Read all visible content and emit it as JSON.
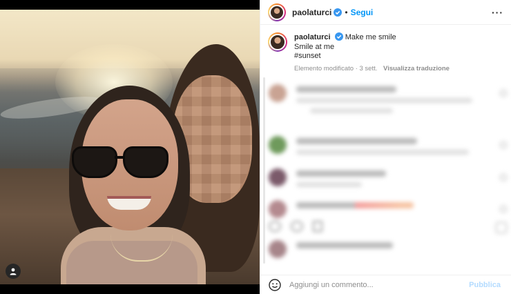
{
  "post": {
    "author": "paolaturci",
    "verified": true,
    "follow_label": "Segui",
    "dot": "•",
    "more_icon": "more-horizontal-icon"
  },
  "caption": {
    "author": "paolaturci",
    "line1": "Make me smile",
    "line2": "Smile at me",
    "line3": "#sunset",
    "meta": "Elemento modificato · 3 sett.",
    "translate": "Visualizza traduzione"
  },
  "footer": {
    "placeholder": "Aggiungi un commento...",
    "publish_label": "Pubblica",
    "emoji_icon": "smiley-icon"
  },
  "colors": {
    "accent": "#0095f6",
    "verified": "#3897f0",
    "publish_disabled": "#b3dbff",
    "muted": "#8e8e8e"
  }
}
